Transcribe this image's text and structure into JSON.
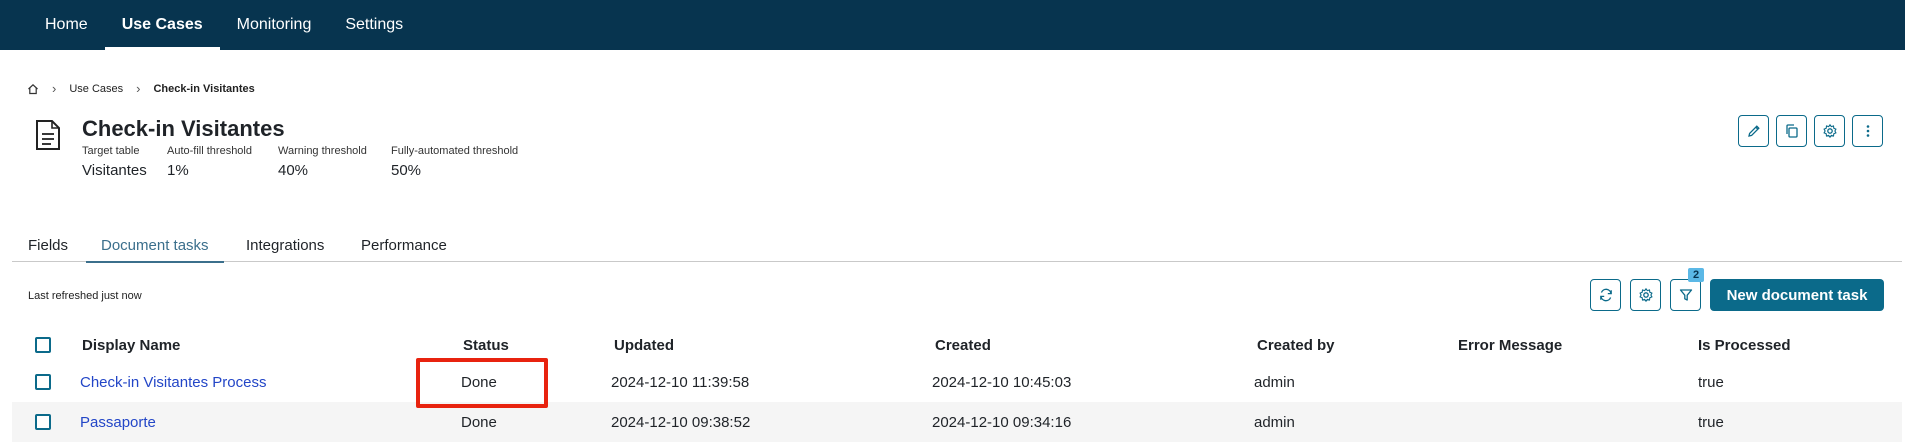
{
  "topnav": {
    "items": [
      {
        "label": "Home"
      },
      {
        "label": "Use Cases",
        "active": true
      },
      {
        "label": "Monitoring"
      },
      {
        "label": "Settings"
      }
    ]
  },
  "breadcrumb": {
    "icon": "home-icon",
    "items": [
      "Use Cases",
      "Check-in Visitantes"
    ]
  },
  "header": {
    "icon": "document-icon",
    "title": "Check-in Visitantes",
    "meta": [
      {
        "label": "Target table",
        "value": "Visitantes"
      },
      {
        "label": "Auto-fill threshold",
        "value": "1%"
      },
      {
        "label": "Warning threshold",
        "value": "40%"
      },
      {
        "label": "Fully-automated threshold",
        "value": "50%"
      }
    ],
    "actions": [
      "edit-icon",
      "copy-icon",
      "gear-icon",
      "more-vertical-icon"
    ]
  },
  "tabs": [
    {
      "label": "Fields"
    },
    {
      "label": "Document tasks",
      "active": true
    },
    {
      "label": "Integrations"
    },
    {
      "label": "Performance"
    }
  ],
  "toolbar": {
    "refreshed_text": "Last refreshed just now",
    "filter_count": "2",
    "new_task_label": "New document task",
    "icons": [
      "refresh-icon",
      "gear-icon",
      "filter-icon"
    ]
  },
  "table": {
    "columns": [
      "Display Name",
      "Status",
      "Updated",
      "Created",
      "Created by",
      "Error Message",
      "Is Processed"
    ],
    "rows": [
      {
        "display_name": "Check-in Visitantes Process",
        "status": "Done",
        "updated": "2024-12-10 11:39:58",
        "created": "2024-12-10 10:45:03",
        "created_by": "admin",
        "error_message": "",
        "is_processed": "true"
      },
      {
        "display_name": "Passaporte",
        "status": "Done",
        "updated": "2024-12-10 09:38:52",
        "created": "2024-12-10 09:34:16",
        "created_by": "admin",
        "error_message": "",
        "is_processed": "true"
      }
    ]
  },
  "colors": {
    "nav_bg": "#07344f",
    "accent": "#0b6a8a",
    "link": "#2346c7",
    "highlight": "#e8230f",
    "badge": "#5bb8e6"
  }
}
